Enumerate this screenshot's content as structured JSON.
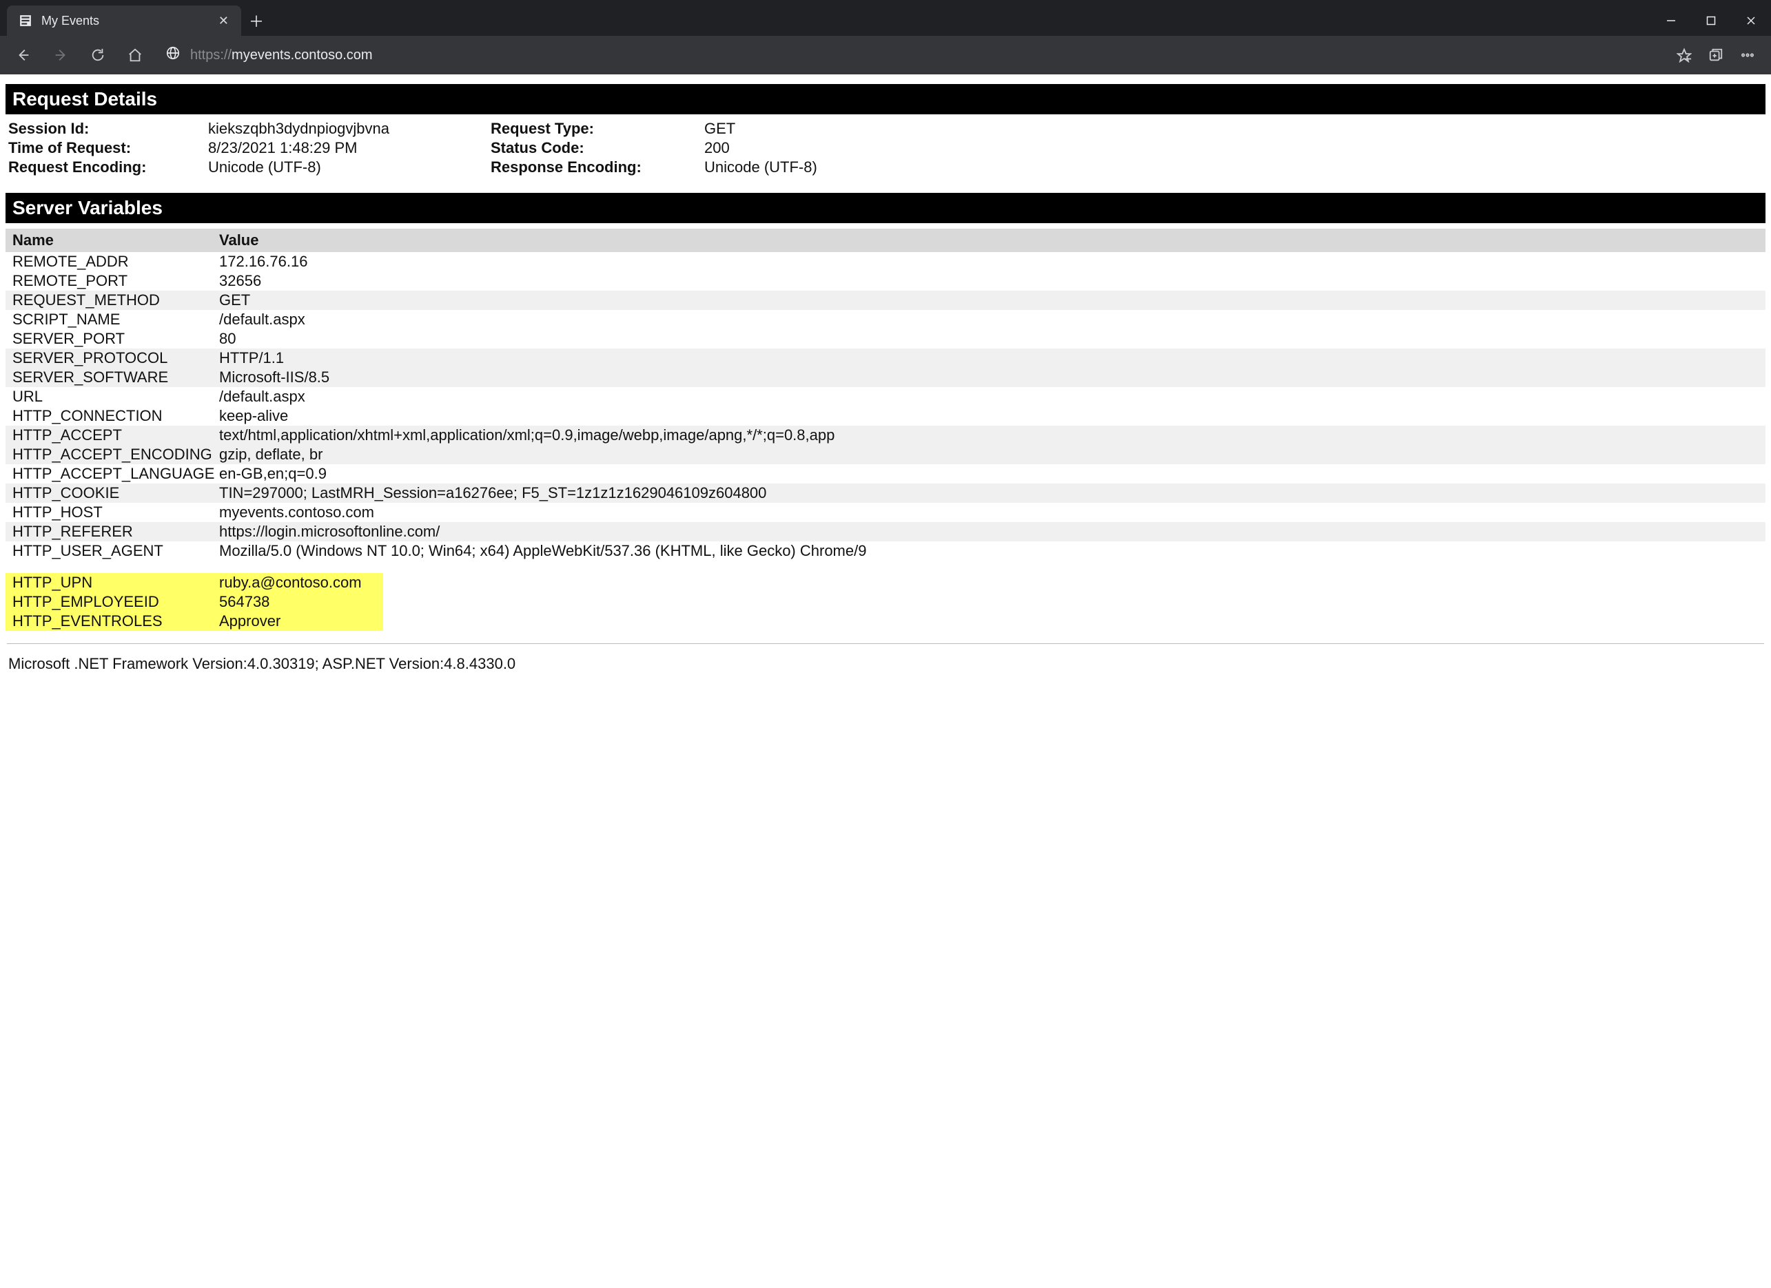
{
  "browser": {
    "tab_title": "My Events",
    "url_proto": "https://",
    "url_host": "myevents.contoso.com"
  },
  "sections": {
    "request_details": "Request Details",
    "server_variables": "Server Variables"
  },
  "request": {
    "labels": {
      "session_id": "Session Id:",
      "time": "Time of Request:",
      "encoding": "Request Encoding:",
      "type": "Request Type:",
      "status": "Status Code:",
      "resp_encoding": "Response Encoding:"
    },
    "session_id": "kiekszqbh3dydnpiogvjbvna",
    "time": "8/23/2021 1:48:29 PM",
    "encoding": "Unicode (UTF-8)",
    "type": "GET",
    "status": "200",
    "resp_encoding": "Unicode (UTF-8)"
  },
  "var_headers": {
    "name": "Name",
    "value": "Value"
  },
  "vars": [
    {
      "n": "REMOTE_ADDR",
      "v": "172.16.76.16"
    },
    {
      "n": "REMOTE_PORT",
      "v": "32656"
    },
    {
      "n": "REQUEST_METHOD",
      "v": "GET"
    },
    {
      "n": "SCRIPT_NAME",
      "v": "/default.aspx"
    },
    {
      "n": "SERVER_PORT",
      "v": "80"
    },
    {
      "n": "SERVER_PROTOCOL",
      "v": "HTTP/1.1"
    },
    {
      "n": "SERVER_SOFTWARE",
      "v": "Microsoft-IIS/8.5"
    },
    {
      "n": "URL",
      "v": "/default.aspx"
    },
    {
      "n": "HTTP_CONNECTION",
      "v": "keep-alive"
    },
    {
      "n": "HTTP_ACCEPT",
      "v": "text/html,application/xhtml+xml,application/xml;q=0.9,image/webp,image/apng,*/*;q=0.8,app"
    },
    {
      "n": "HTTP_ACCEPT_ENCODING",
      "v": "gzip, deflate, br"
    },
    {
      "n": "HTTP_ACCEPT_LANGUAGE",
      "v": "en-GB,en;q=0.9"
    },
    {
      "n": "HTTP_COOKIE",
      "v": "TIN=297000; LastMRH_Session=a16276ee; F5_ST=1z1z1z1629046109z604800"
    },
    {
      "n": "HTTP_HOST",
      "v": "myevents.contoso.com"
    },
    {
      "n": "HTTP_REFERER",
      "v": "https://login.microsoftonline.com/"
    },
    {
      "n": "HTTP_USER_AGENT",
      "v": "Mozilla/5.0 (Windows NT 10.0; Win64; x64) AppleWebKit/537.36 (KHTML, like Gecko) Chrome/9"
    }
  ],
  "highlight": [
    {
      "n": "HTTP_UPN",
      "v": "ruby.a@contoso.com"
    },
    {
      "n": "HTTP_EMPLOYEEID",
      "v": "564738"
    },
    {
      "n": "HTTP_EVENTROLES",
      "v": "Approver"
    }
  ],
  "footer": "Microsoft .NET Framework Version:4.0.30319; ASP.NET Version:4.8.4330.0"
}
